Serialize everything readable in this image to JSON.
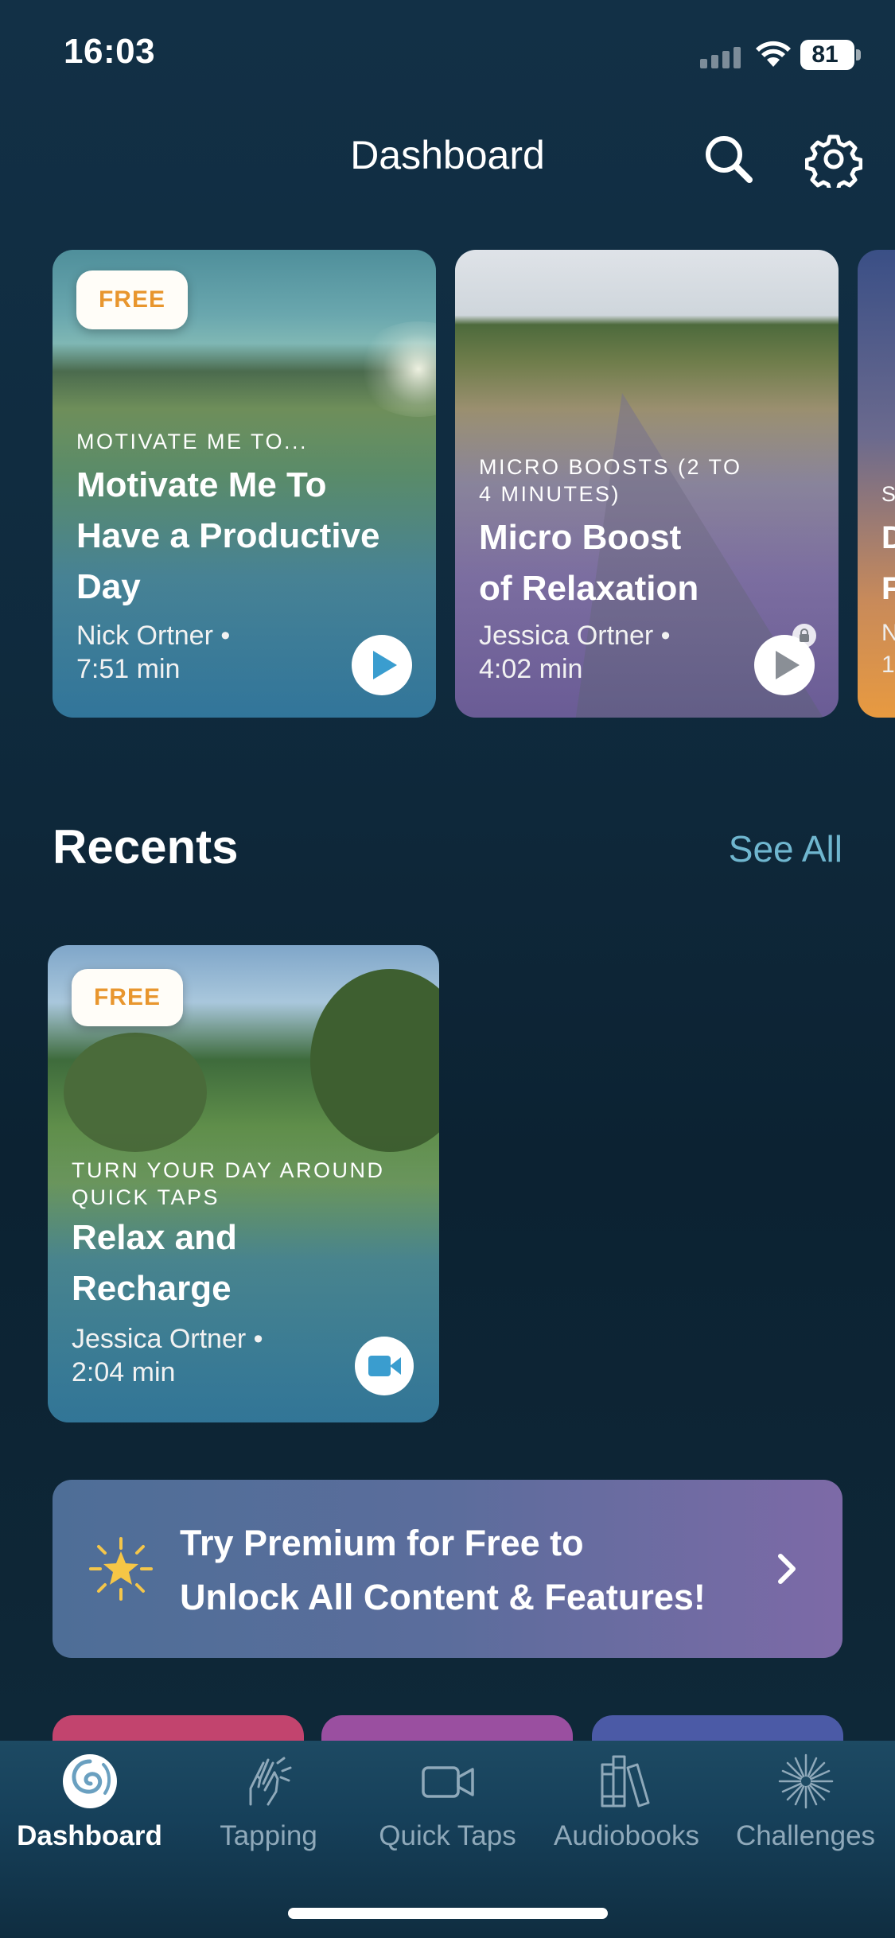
{
  "status_bar": {
    "time": "16:03",
    "battery": "81"
  },
  "header": {
    "title": "Dashboard"
  },
  "featured": [
    {
      "badge": "FREE",
      "category": "MOTIVATE ME TO...",
      "title_lines": [
        "Motivate Me To",
        "Have a Productive",
        "Day"
      ],
      "author": "Nick Ortner •",
      "duration": "7:51 min",
      "action": "play-icon",
      "locked": false
    },
    {
      "badge": "",
      "category_lines": [
        "MICRO BOOSTS (2 TO",
        "4 MINUTES)"
      ],
      "title_lines": [
        "Micro Boost",
        "of Relaxation"
      ],
      "author": "Jessica Ortner •",
      "duration": "4:02 min",
      "action": "play-icon",
      "locked": true
    },
    {
      "partial_lines": [
        "D",
        "F"
      ],
      "category_partial": "S",
      "meta_partial": [
        "N",
        "1"
      ]
    }
  ],
  "recents": {
    "title": "Recents",
    "see_all": "See All",
    "items": [
      {
        "badge": "FREE",
        "category_lines": [
          "TURN YOUR DAY AROUND",
          "QUICK TAPS"
        ],
        "title_lines": [
          "Relax and",
          "Recharge"
        ],
        "author": "Jessica Ortner •",
        "duration": "2:04 min",
        "action": "video-icon"
      }
    ]
  },
  "premium_banner": {
    "lines": [
      "Try Premium for Free to",
      "Unlock All Content & Features!"
    ]
  },
  "tabs": [
    {
      "label": "Dashboard",
      "icon": "swirl-logo-icon",
      "active": true
    },
    {
      "label": "Tapping",
      "icon": "tapping-hands-icon",
      "active": false
    },
    {
      "label": "Quick Taps",
      "icon": "video-camera-icon",
      "active": false
    },
    {
      "label": "Audiobooks",
      "icon": "books-icon",
      "active": false
    },
    {
      "label": "Challenges",
      "icon": "sparkle-burst-icon",
      "active": false
    }
  ],
  "colors": {
    "accent": "#6fb6cf",
    "badge_text": "#e8962e",
    "play": "#3a9dcf",
    "peek_tiles": [
      "#c2446e",
      "#9a4fa0",
      "#4b5aa6"
    ]
  }
}
